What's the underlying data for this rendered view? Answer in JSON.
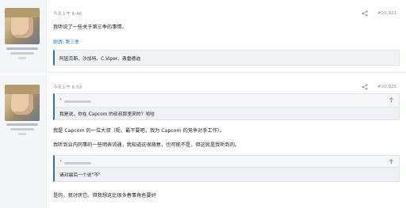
{
  "post1": {
    "time": "今天上午 6:46",
    "number": "#20,921",
    "text": "我听说了一些关于第三季的事情。",
    "spoiler_link": "剧透: 第三季",
    "spoiler_content": "阿因克斯、沙加特、C.Viper、弗雷德迪"
  },
  "post2": {
    "time": "今天上午 6:53",
    "number": "#20,925",
    "quote1_body": "我是说，你在 Capcom 的叔叔那里来的？哈哈",
    "line1": "我是 Capcom 的一位大叔（呃，最不要吧，我为 Capcom 的竞争对手工作）。",
    "line2": "我听到业内同事的一些明表流通，我知道这很随意，也可能不是，但这就是我听到的。",
    "quote2_body": "请对最后一个说\"不\"",
    "line3": "是的，我讨厌它。但我想这比很多春事角色要好"
  }
}
